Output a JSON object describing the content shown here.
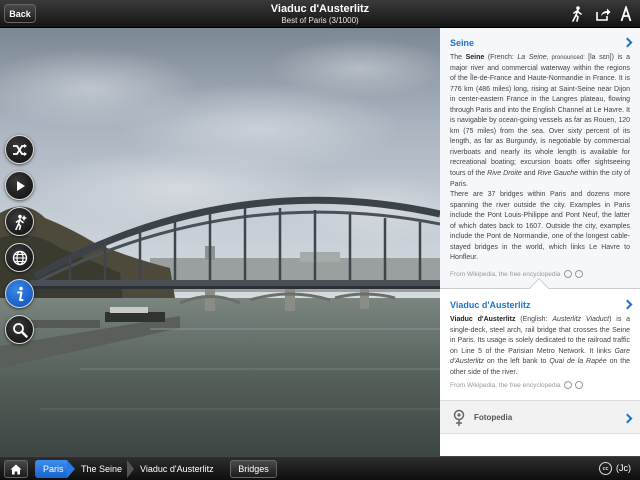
{
  "topbar": {
    "back_label": "Back",
    "title": "Viaduc d'Austerlitz",
    "subtitle": "Best of Paris (3/1000)",
    "icons": [
      "walk-icon",
      "share-icon",
      "text-size-icon"
    ]
  },
  "sidebar_tools": [
    {
      "name": "shuffle-icon",
      "active": false
    },
    {
      "name": "play-icon",
      "active": false
    },
    {
      "name": "explore-icon",
      "active": false
    },
    {
      "name": "globe-icon",
      "active": false
    },
    {
      "name": "info-icon",
      "active": true
    },
    {
      "name": "zoom-icon",
      "active": false
    }
  ],
  "cards": {
    "seine": {
      "title": "Seine",
      "body_name": "Seine",
      "body_fr_prefix": "(French: ",
      "body_fr": "La Seine",
      "body_pron": ", pronounced: ",
      "body_ipa": "[la sɛn]",
      "body_p1": ") is a major river and commercial waterway within the regions of the Île-de-France and Haute-Normandie in France. It is 776 km (486 miles) long, rising at Saint-Seine near Dijon in center-eastern France in the Langres plateau, flowing through Paris and into the English Channel at Le Havre. It is navigable by ocean-going vessels as far as Rouen, 120 km (75 miles) from the sea. Over sixty percent of its length, as far as Burgundy, is negotiable by commercial riverboats and nearly its whole length is available for recreational boating; excursion boats offer sightseeing tours of the ",
      "body_rd": "Rive Droite",
      "body_and": " and ",
      "body_rg": "Rive Gauche",
      "body_p1_end": " within the city of Paris.",
      "body_p2": "There are 37 bridges within Paris and dozens more spanning the river outside the city. Examples in Paris include the Pont Louis-Philippe and Pont Neuf, the latter of which dates back to 1607. Outside the city, examples include the Pont de Normandie, one of the longest cable-stayed bridges in the world, which links Le Havre to Honfleur.",
      "source": "From Wikipedia, the free encyclopedia"
    },
    "viaduc": {
      "title": "Viaduc d'Austerlitz",
      "body_name": "Viaduc d'Austerlitz",
      "body_en_prefix": " (English: ",
      "body_en": "Austerlitz Viaduct",
      "body_p1": ") is a single-deck, steel arch, rail bridge that crosses the Seine in Paris. Its usage is solely dedicated to the railroad traffic on Line 5 of the Parisian Metro Network. It links ",
      "body_gare": "Gare d'Austerlitz",
      "body_mid": " on the left bank to ",
      "body_quai": "Quai de la Rapée",
      "body_end": " on the other side of the river.",
      "source": "From Wikipedia, the free encyclopedia"
    },
    "fotopedia": {
      "label": "Fotopedia"
    }
  },
  "bottombar": {
    "breadcrumbs": [
      "Paris",
      "The Seine",
      "Viaduc d'Austerlitz"
    ],
    "bridges_label": "Bridges",
    "cc_label": "cc",
    "credit": "(Jc)"
  },
  "colors": {
    "accent": "#1e73c9",
    "crumb_active": "#2a7ae2",
    "bar_dark": "#1a1a1a"
  }
}
